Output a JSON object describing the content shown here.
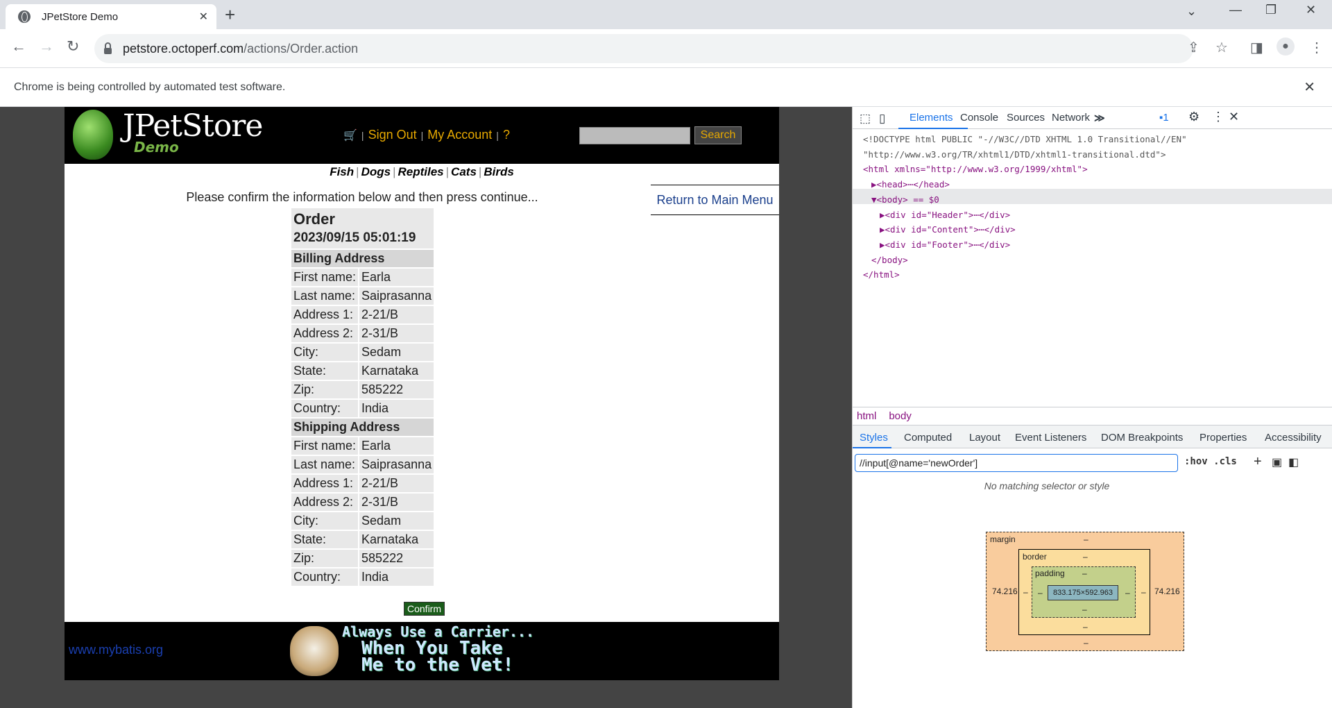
{
  "browser": {
    "tab_title": "JPetStore Demo",
    "tab_close": "✕",
    "new_tab": "+",
    "url_host": "petstore.octoperf.com",
    "url_path": "/actions/Order.action",
    "infobar_text": "Chrome is being controlled by automated test software.",
    "infobar_close": "✕"
  },
  "site": {
    "logo_text": "JPetStore",
    "logo_sub": "Demo",
    "menu": {
      "sign_out": "Sign Out",
      "my_account": "My Account",
      "help": "?"
    },
    "search_button": "Search",
    "categories": [
      "Fish",
      "Dogs",
      "Reptiles",
      "Cats",
      "Birds"
    ],
    "return_link": "Return to Main Menu",
    "confirm_message": "Please confirm the information below and then press continue...",
    "order": {
      "title": "Order",
      "date": "2023/09/15 05:01:19",
      "billing_heading": "Billing Address",
      "shipping_heading": "Shipping Address",
      "billing": [
        [
          "First name:",
          "Earla"
        ],
        [
          "Last name:",
          "Saiprasanna"
        ],
        [
          "Address 1:",
          "2-21/B"
        ],
        [
          "Address 2:",
          "2-31/B"
        ],
        [
          "City:",
          "Sedam"
        ],
        [
          "State:",
          "Karnataka"
        ],
        [
          "Zip:",
          "585222"
        ],
        [
          "Country:",
          "India"
        ]
      ],
      "shipping": [
        [
          "First name:",
          "Earla"
        ],
        [
          "Last name:",
          "Saiprasanna"
        ],
        [
          "Address 1:",
          "2-21/B"
        ],
        [
          "Address 2:",
          "2-31/B"
        ],
        [
          "City:",
          "Sedam"
        ],
        [
          "State:",
          "Karnataka"
        ],
        [
          "Zip:",
          "585222"
        ],
        [
          "Country:",
          "India"
        ]
      ],
      "confirm_button": "Confirm"
    },
    "footer_link": "www.mybatis.org",
    "banner_lines": [
      "Always Use a Carrier...",
      "When You Take",
      "Me to the Vet!"
    ]
  },
  "devtools": {
    "tabs": [
      "Elements",
      "Console",
      "Sources",
      "Network"
    ],
    "more_tabs": "≫",
    "issues_count": "1",
    "source_lines": [
      {
        "indent": 0,
        "text": "<!DOCTYPE html PUBLIC \"-//W3C//DTD XHTML 1.0 Transitional//EN\"",
        "kind": "doc"
      },
      {
        "indent": 0,
        "text": "\"http://www.w3.org/TR/xhtml1/DTD/xhtml1-transitional.dtd\">",
        "kind": "doc"
      },
      {
        "indent": 0,
        "text": "<html xmlns=\"http://www.w3.org/1999/xhtml\">",
        "kind": "tag"
      },
      {
        "indent": 1,
        "text": "▶<head>⋯</head>",
        "kind": "tag"
      },
      {
        "indent": 1,
        "text": "▼<body> == $0",
        "kind": "tag"
      },
      {
        "indent": 2,
        "text": "▶<div id=\"Header\">⋯</div>",
        "kind": "tag"
      },
      {
        "indent": 2,
        "text": "▶<div id=\"Content\">⋯</div>",
        "kind": "tag"
      },
      {
        "indent": 2,
        "text": "▶<div id=\"Footer\">⋯</div>",
        "kind": "tag"
      },
      {
        "indent": 1,
        "text": "</body>",
        "kind": "tag"
      },
      {
        "indent": 0,
        "text": "</html>",
        "kind": "tag"
      }
    ],
    "breadcrumbs": [
      "html",
      "body"
    ],
    "style_tabs": [
      "Styles",
      "Computed",
      "Layout",
      "Event Listeners",
      "DOM Breakpoints",
      "Properties",
      "Accessibility"
    ],
    "filter_value": "//input[@name='newOrder']",
    "filter_tools": ":hov  .cls",
    "no_match": "No matching selector or style",
    "box_model": {
      "margin_label": "margin",
      "border_label": "border",
      "padding_label": "padding",
      "content_size": "833.175×592.963",
      "margin_left": "74.216",
      "margin_right": "74.216",
      "dash": "–"
    }
  }
}
